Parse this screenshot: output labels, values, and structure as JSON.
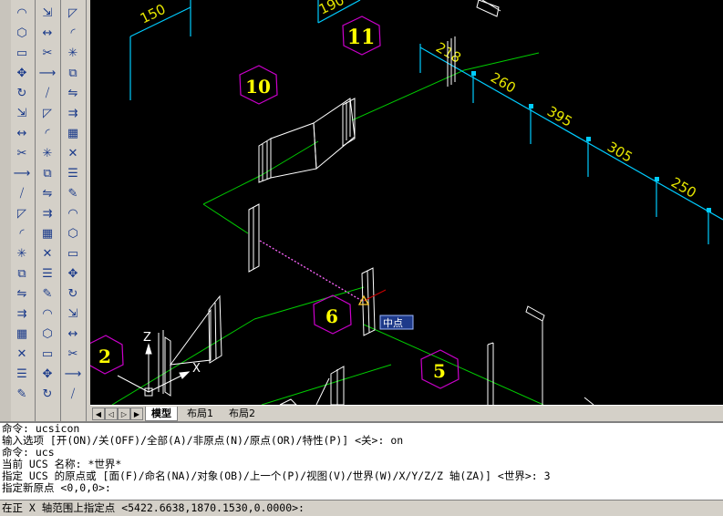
{
  "colors": {
    "background": "#000000",
    "pipe_green": "#00cc00",
    "dim_cyan": "#00ccff",
    "dim_text": "#e6e600",
    "circle_magenta": "#cc00cc",
    "number_yellow": "#ffff00",
    "object_white": "#ffffff"
  },
  "toolbar_icons": [
    "arc-icon",
    "polygon-icon",
    "rectangle-icon",
    "move-icon",
    "rotate-icon",
    "scale-icon",
    "stretch-icon",
    "trim-icon",
    "extend-icon",
    "break-icon",
    "chamfer-icon",
    "fillet-icon",
    "explode-icon",
    "copy-icon",
    "mirror-icon",
    "offset-icon",
    "array-icon",
    "erase-icon",
    "properties-icon",
    "match-icon"
  ],
  "canvas": {
    "dimensions": [
      "150",
      "190",
      "218",
      "260",
      "395",
      "305",
      "250"
    ],
    "circle_labels": [
      "11",
      "10",
      "6",
      "2",
      "5"
    ],
    "tooltip": "中点",
    "axis_z": "Z",
    "axis_x": "X"
  },
  "tabs": {
    "model": "模型",
    "layout1": "布局1",
    "layout2": "布局2"
  },
  "command_history": [
    "命令: ucsicon",
    "输入选项 [开(ON)/关(OFF)/全部(A)/非原点(N)/原点(OR)/特性(P)] <关>: on",
    "命令: ucs",
    "当前 UCS 名称: *世界*",
    "指定 UCS 的原点或 [面(F)/命名(NA)/对象(OB)/上一个(P)/视图(V)/世界(W)/X/Y/Z/Z 轴(ZA)] <世界>: 3",
    "指定新原点 <0,0,0>:"
  ],
  "command_prompt": "在正 X 轴范围上指定点 <5422.6638,1870.1530,0.0000>:"
}
